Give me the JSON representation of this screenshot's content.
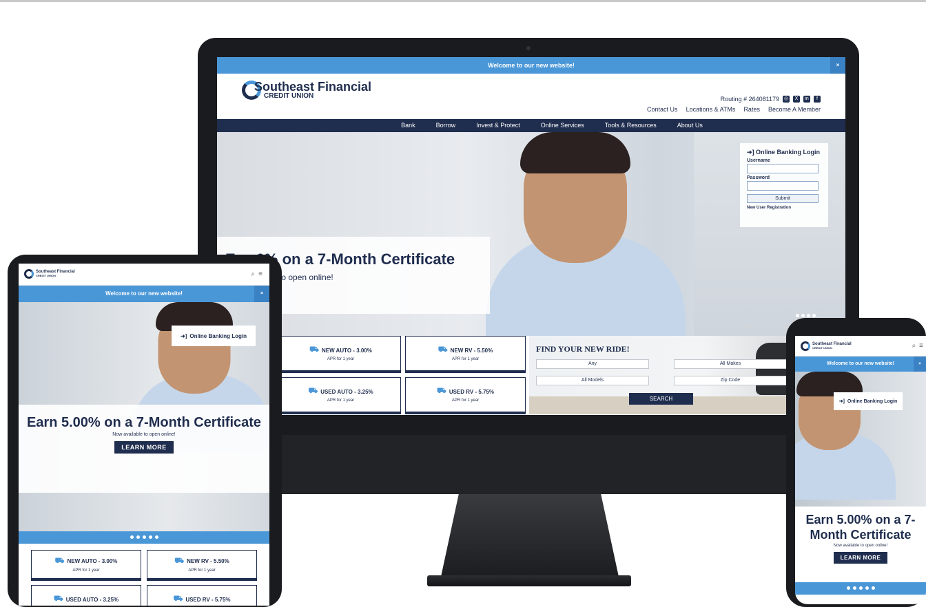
{
  "brand": {
    "name": "Southeast Financial",
    "sub": "CREDIT UNION",
    "accent": "#4a97d8",
    "navy": "#1f2d4e"
  },
  "desktop": {
    "banner": {
      "text": "Welcome to our new website!",
      "close": "×"
    },
    "routing": "Routing # 264081179",
    "social_icons": [
      "instagram-icon",
      "x-icon",
      "linkedin-icon",
      "facebook-icon"
    ],
    "util_nav": [
      "Contact Us",
      "Locations & ATMs",
      "Rates",
      "Become A Member"
    ],
    "main_nav": [
      "Bank",
      "Borrow",
      "Invest & Protect",
      "Online Services",
      "Tools & Resources",
      "About Us"
    ],
    "hero": {
      "headline": "Earn 5.00% on a 7-Month Certificate",
      "visible_headline": "0% on a 7-Month Certificate",
      "fragment_prefix": "E",
      "sub": "to open online!"
    },
    "login": {
      "title": "Online Banking Login",
      "username_label": "Username",
      "password_label": "Password",
      "submit": "Submit",
      "register": "New User Registration"
    },
    "rates": [
      {
        "name": "NEW AUTO - 3.00%",
        "apr": "APR for 1 year",
        "icon": "car-icon"
      },
      {
        "name": "NEW RV - 5.50%",
        "apr": "APR for 1 year",
        "icon": "rv-icon"
      },
      {
        "name": "USED AUTO - 3.25%",
        "apr": "APR for 1 year",
        "icon": "car-icon"
      },
      {
        "name": "USED RV - 5.75%",
        "apr": "APR for 1 year",
        "icon": "rv-icon"
      }
    ],
    "ride": {
      "title": "FIND YOUR NEW RIDE!",
      "selects": [
        "Any",
        "All Makes",
        "All Models",
        "Zip Code"
      ],
      "search": "SEARCH"
    }
  },
  "tablet": {
    "banner": "Welcome to our new website!",
    "login": "Online Banking Login",
    "headline": "Earn 5.00% on a 7-Month Certificate",
    "sub": "Now available to open online!",
    "cta": "LEARN MORE",
    "rates": [
      {
        "name": "NEW AUTO - 3.00%",
        "apr": "APR for 1 year"
      },
      {
        "name": "NEW RV - 5.50%",
        "apr": "APR for 1 year"
      },
      {
        "name": "USED AUTO - 3.25%"
      },
      {
        "name": "USED RV - 5.75%"
      }
    ]
  },
  "phone": {
    "banner": "Welcome to our new website!",
    "login": "Online Banking Login",
    "headline": "Earn 5.00% on a 7-Month Certificate",
    "sub": "Now available to open online!",
    "cta": "LEARN MORE"
  }
}
